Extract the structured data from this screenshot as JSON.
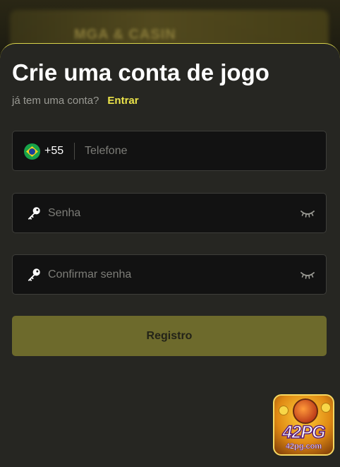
{
  "banner": {
    "text": "MGA & CASIN"
  },
  "form": {
    "title": "Crie uma conta de jogo",
    "subtitle": "já tem uma conta?",
    "login_link": "Entrar",
    "phone": {
      "country_code": "+55",
      "flag": "brazil-flag-icon",
      "placeholder": "Telefone",
      "value": ""
    },
    "password": {
      "placeholder": "Senha",
      "value": "",
      "icon": "key-icon",
      "toggle_icon": "eye-closed-icon"
    },
    "confirm_password": {
      "placeholder": "Confirmar senha",
      "value": "",
      "icon": "key-icon",
      "toggle_icon": "eye-closed-icon"
    },
    "register_label": "Registro"
  },
  "logo": {
    "brand": "42PG",
    "domain": "42pg.com"
  },
  "colors": {
    "accent": "#ece44a",
    "sheet_background": "#262622",
    "field_background": "#121212",
    "button_background": "#6d6a2c",
    "sheet_border": "#d7d24a"
  }
}
